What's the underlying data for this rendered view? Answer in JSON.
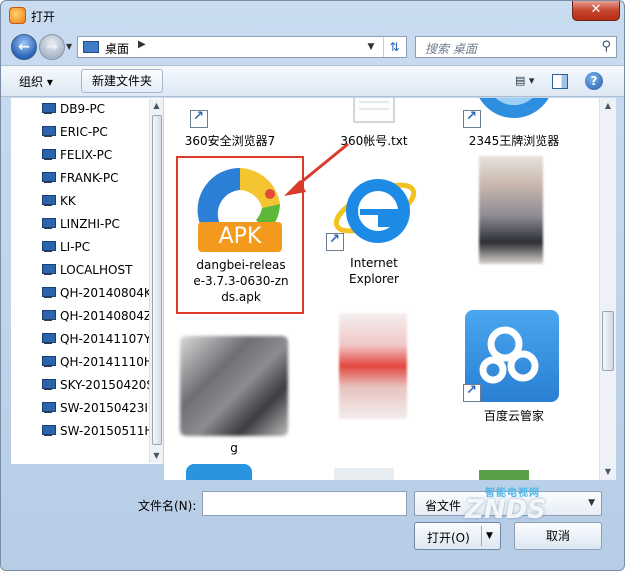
{
  "window": {
    "title": "打开",
    "close_label": "✕"
  },
  "nav": {
    "back_icon": "back-arrow-icon",
    "forward_icon": "forward-arrow-icon",
    "address_segments": [
      "桌面"
    ],
    "search_placeholder": "搜索 桌面"
  },
  "toolbar": {
    "organize_label": "组织 ▾",
    "new_folder_label": "新建文件夹"
  },
  "tree": [
    "DB9-PC",
    "ERIC-PC",
    "FELIX-PC",
    "FRANK-PC",
    "KK",
    "LINZHI-PC",
    "LI-PC",
    "LOCALHOST",
    "QH-20140804K",
    "QH-20140804Z",
    "QH-20141107Y",
    "QH-20141110H",
    "SKY-20150420S",
    "SW-20150423I",
    "SW-20150511H"
  ],
  "files": {
    "row0": [
      "360安全浏览器7",
      "360帐号.txt",
      "2345王牌浏览器"
    ],
    "apk": {
      "badge": "APK",
      "caption_lines": [
        "dangbei-releas",
        "e-3.7.3-0630-zn",
        "ds.apk"
      ]
    },
    "ie": {
      "caption_lines": [
        "Internet",
        "Explorer"
      ]
    },
    "baidu": {
      "caption": "百度云管家"
    },
    "blur_g": {
      "caption": "g"
    }
  },
  "bottom": {
    "filename_label": "文件名(N):",
    "filename_value": "",
    "filetype_value": "省文件",
    "open_label": "打开(O)",
    "cancel_label": "取消"
  },
  "watermark": {
    "top": "智能电视网",
    "logo": "ZNDS"
  },
  "colors": {
    "highlight_red": "#d93a2b",
    "apk_orange": "#f39a1e",
    "baidu_blue": "#2f8ee0"
  }
}
